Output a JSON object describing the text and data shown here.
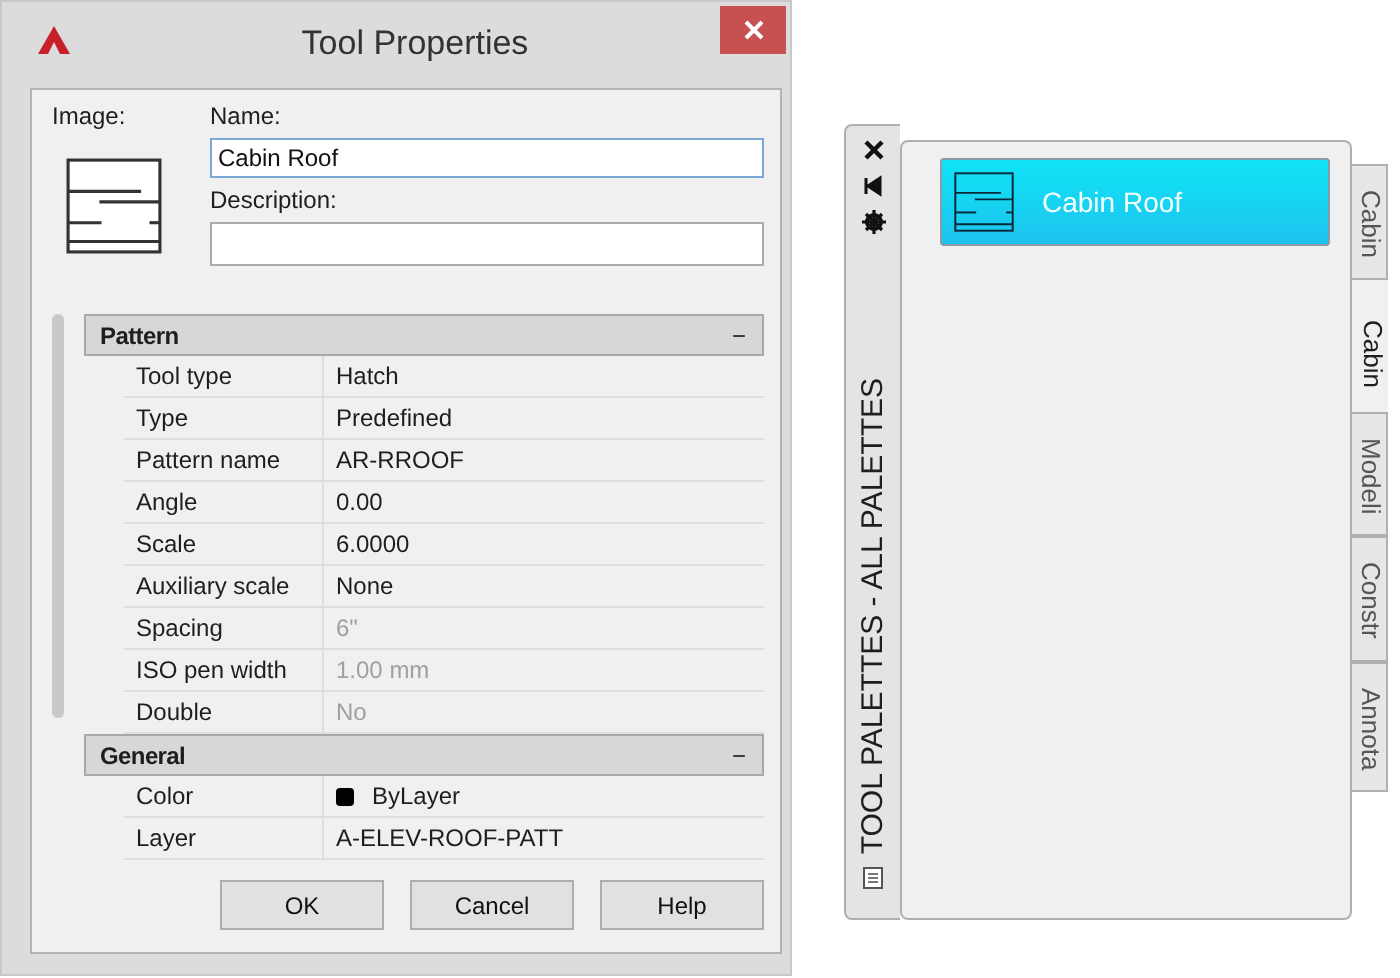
{
  "dialog": {
    "title": "Tool Properties",
    "image_label": "Image:",
    "name_label": "Name:",
    "name_value": "Cabin Roof",
    "description_label": "Description:",
    "sections": [
      {
        "title": "Pattern",
        "toggle": "−",
        "rows": [
          {
            "kind": "text",
            "label": "Tool type",
            "value": "Hatch",
            "disabled": false
          },
          {
            "kind": "text",
            "label": "Type",
            "value": "Predefined",
            "disabled": false
          },
          {
            "kind": "text",
            "label": "Pattern name",
            "value": "AR-RROOF",
            "disabled": false
          },
          {
            "kind": "text",
            "label": "Angle",
            "value": "0.00",
            "disabled": false
          },
          {
            "kind": "text",
            "label": "Scale",
            "value": "6.0000",
            "disabled": false
          },
          {
            "kind": "text",
            "label": "Auxiliary scale",
            "value": "None",
            "disabled": false
          },
          {
            "kind": "text",
            "label": "Spacing",
            "value": "6\"",
            "disabled": true
          },
          {
            "kind": "text",
            "label": "ISO pen width",
            "value": "1.00 mm",
            "disabled": true
          },
          {
            "kind": "text",
            "label": "Double",
            "value": "No",
            "disabled": true
          }
        ]
      },
      {
        "title": "General",
        "toggle": "−",
        "rows": [
          {
            "kind": "color",
            "label": "Color",
            "value": "ByLayer",
            "disabled": false
          },
          {
            "kind": "text",
            "label": "Layer",
            "value": "A-ELEV-ROOF-PATT",
            "disabled": false
          }
        ]
      }
    ],
    "buttons": [
      "OK",
      "Cancel",
      "Help"
    ]
  },
  "palette": {
    "title": "TOOL PALETTES - ALL PALETTES",
    "tools": [
      {
        "label": "Cabin Roof",
        "selected": true
      }
    ],
    "tabs": [
      {
        "label": "Cabin",
        "selected": false
      },
      {
        "label": "Cabin",
        "selected": true
      },
      {
        "label": "Modeli",
        "selected": false
      },
      {
        "label": "Constr",
        "selected": false
      },
      {
        "label": "Annota",
        "selected": false
      }
    ]
  }
}
